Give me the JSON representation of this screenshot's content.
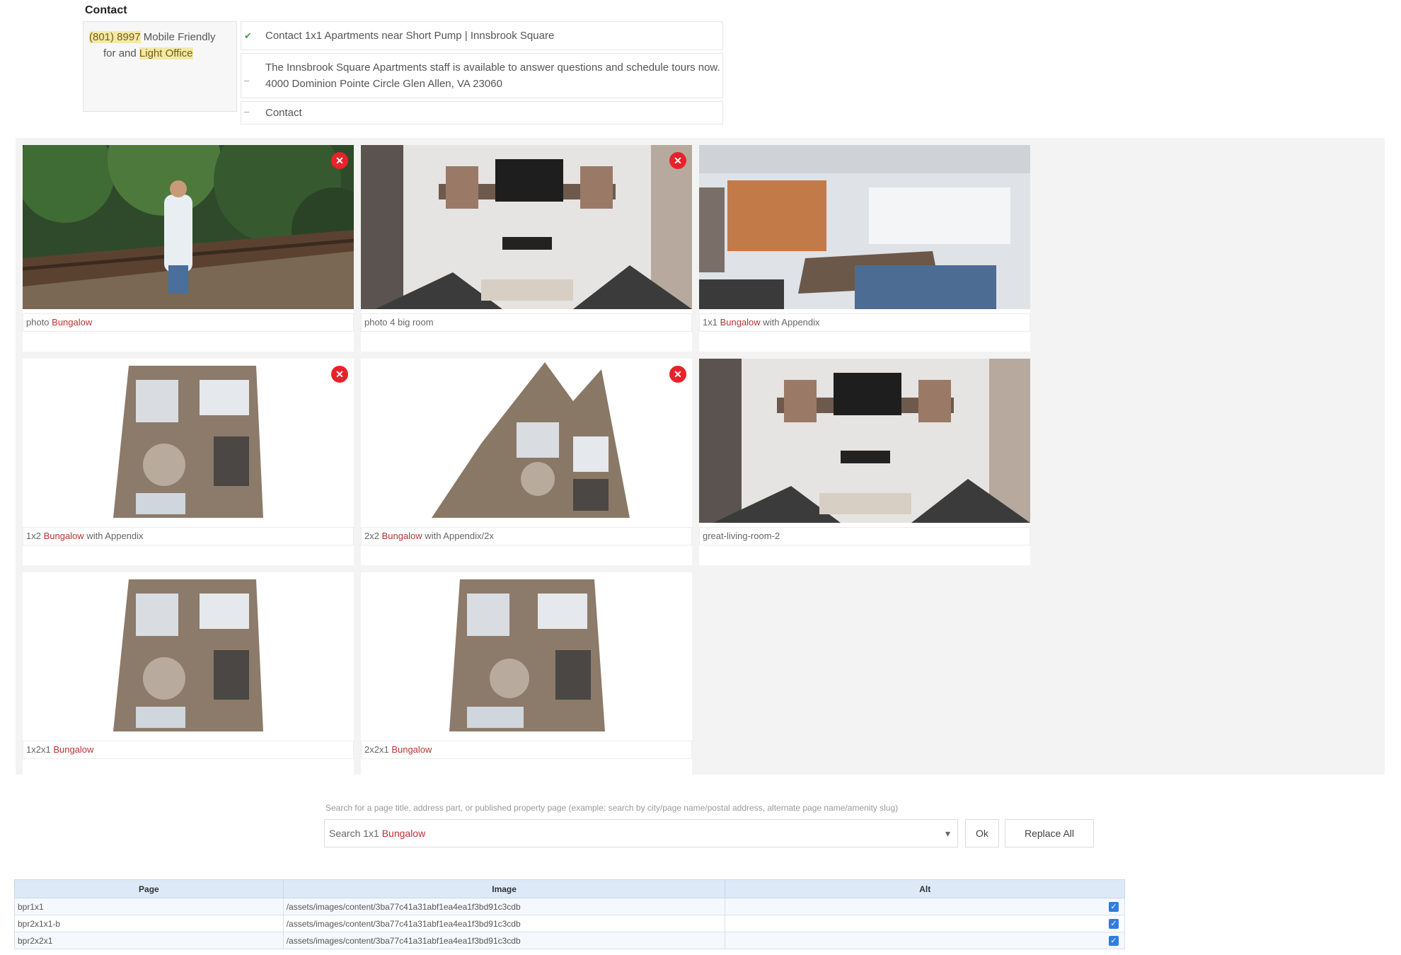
{
  "contact": {
    "heading": "Contact",
    "line1_hl1": "(801) 8997",
    "line1_rest": "Mobile Friendly",
    "line2_a": "for",
    "line2_b": "and",
    "line2_hl": "Light Office",
    "fields": [
      "Contact 1x1 Apartments near Short Pump | Innsbrook Square",
      "The Innsbrook Square Apartments staff is available to answer questions and schedule tours now. 4000 Dominion Pointe Circle Glen Allen, VA 23060",
      "Contact"
    ]
  },
  "gallery": {
    "items": [
      {
        "caption_main": "photo ",
        "caption_red": "Bungalow",
        "has_remove": true
      },
      {
        "caption_main": "photo 4 big room",
        "caption_red": "",
        "has_remove": true
      },
      {
        "caption_main": "1x1 ",
        "caption_red": "Bungalow",
        "caption_tail": " with Appendix",
        "has_remove": false
      },
      {
        "caption_main": "1x2 ",
        "caption_red": "Bungalow",
        "caption_tail": " with Appendix",
        "has_remove": true
      },
      {
        "caption_main": "2x2 ",
        "caption_red": "Bungalow",
        "caption_tail": " with Appendix/2x",
        "has_remove": true
      },
      {
        "caption_main": "great-living-room-2",
        "caption_red": "",
        "has_remove": false
      },
      {
        "caption_main": "1x2x1 ",
        "caption_red": "Bungalow",
        "has_remove": false
      },
      {
        "caption_main": "2x2x1 ",
        "caption_red": "Bungalow",
        "has_remove": false
      }
    ],
    "remove_glyph": "✕"
  },
  "search": {
    "help": "Search for a page title, address part, or published property page (example: search by city/page name/postal address, alternate page name/amenity slug)",
    "value_main": "Search 1x1 ",
    "value_red": "Bungalow",
    "ok_label": "Ok",
    "replace_label": "Replace All"
  },
  "table": {
    "headers": [
      "Page",
      "Image",
      "Alt"
    ],
    "rows": [
      {
        "page": "bpr1x1",
        "image": "/assets/images/content/3ba77c41a31abf1ea4ea1f3bd91c3cdb",
        "alt": ""
      },
      {
        "page": "bpr2x1x1-b",
        "image": "/assets/images/content/3ba77c41a31abf1ea4ea1f3bd91c3cdb",
        "alt": ""
      },
      {
        "page": "bpr2x2x1",
        "image": "/assets/images/content/3ba77c41a31abf1ea4ea1f3bd91c3cdb",
        "alt": ""
      }
    ]
  },
  "icons": {
    "remove": "close-icon",
    "chevron": "chevron-down-icon",
    "check": "checkbox-icon",
    "field_markers": [
      "check-icon",
      "dash-icon",
      "dash-icon"
    ]
  },
  "colors": {
    "remove_badge": "#e8222a",
    "highlight": "#f2e9a6",
    "link_red": "#b33333",
    "header_blue": "#dde9f7",
    "checkbox_blue": "#2f7de1"
  }
}
